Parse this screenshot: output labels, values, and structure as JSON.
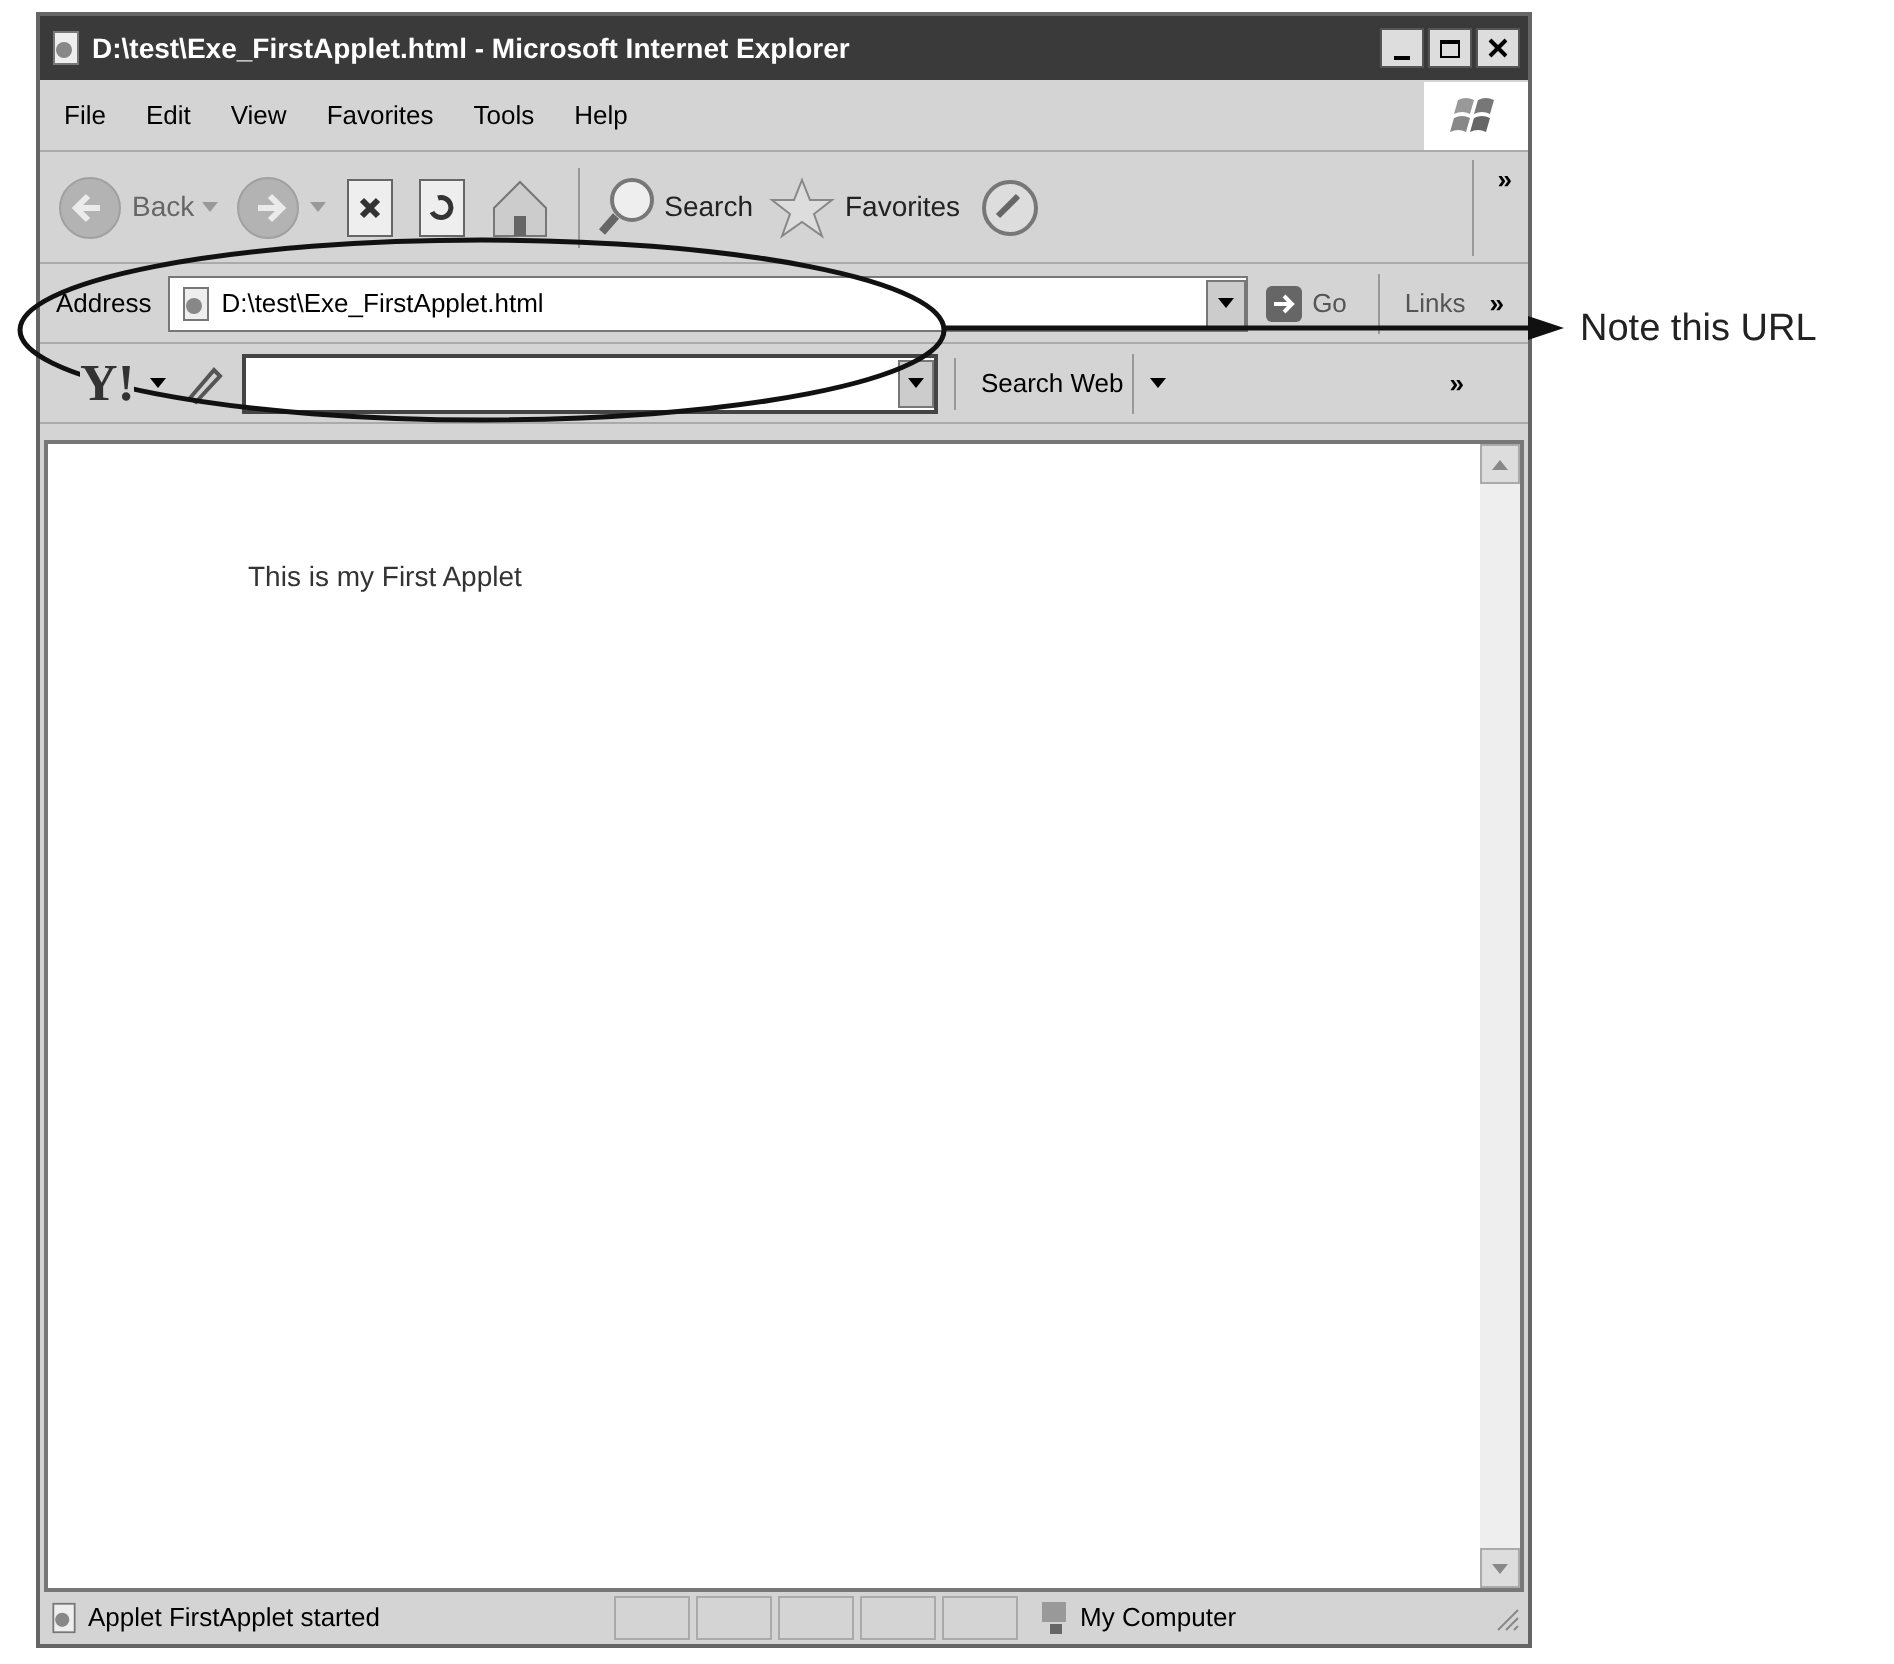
{
  "window": {
    "title": "D:\\test\\Exe_FirstApplet.html - Microsoft Internet Explorer"
  },
  "menu": [
    "File",
    "Edit",
    "View",
    "Favorites",
    "Tools",
    "Help"
  ],
  "toolbar": [
    {
      "kind": "back",
      "label": "Back",
      "disabled": true
    },
    {
      "kind": "forward",
      "disabled": true
    },
    {
      "kind": "stop"
    },
    {
      "kind": "refresh"
    },
    {
      "kind": "home"
    },
    {
      "kind": "search",
      "label": "Search"
    },
    {
      "kind": "favorites",
      "label": "Favorites"
    },
    {
      "kind": "media"
    }
  ],
  "toolbar_more": "»",
  "address_bar": {
    "label": "Address",
    "url": "D:\\test\\Exe_FirstApplet.html",
    "go": "Go",
    "links": "Links",
    "more": "»"
  },
  "yahoo_bar": {
    "logo": "Y!",
    "search_button": "Search Web",
    "more": "»"
  },
  "page": {
    "text": "This is my First Applet"
  },
  "status_bar": {
    "text": "Applet FirstApplet started",
    "zone": "My Computer"
  },
  "annotation": {
    "note": "Note this URL"
  }
}
